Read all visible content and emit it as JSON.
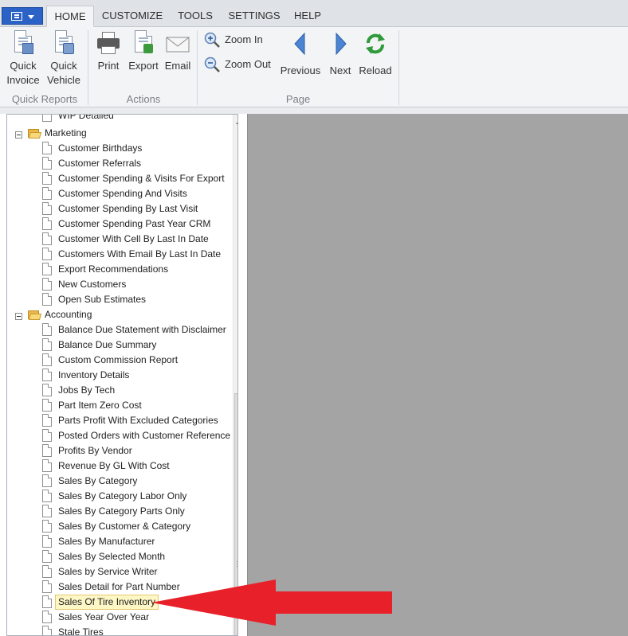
{
  "tabs": [
    {
      "label": "HOME",
      "active": true
    },
    {
      "label": "CUSTOMIZE",
      "active": false
    },
    {
      "label": "TOOLS",
      "active": false
    },
    {
      "label": "SETTINGS",
      "active": false
    },
    {
      "label": "HELP",
      "active": false
    }
  ],
  "ribbon": {
    "quick_reports": {
      "group_label": "Quick Reports",
      "buttons": [
        {
          "line1": "Quick",
          "line2": "Invoice",
          "icon": "invoice-icon"
        },
        {
          "line1": "Quick",
          "line2": "Vehicle",
          "icon": "vehicle-report-icon"
        }
      ]
    },
    "actions": {
      "group_label": "Actions",
      "buttons": [
        {
          "label": "Print",
          "icon": "printer-icon"
        },
        {
          "label": "Export",
          "icon": "export-icon"
        },
        {
          "label": "Email",
          "icon": "envelope-icon"
        }
      ]
    },
    "page": {
      "group_label": "Page",
      "zoom_in": "Zoom In",
      "zoom_out": "Zoom Out",
      "previous": "Previous",
      "next": "Next",
      "reload": "Reload"
    }
  },
  "tree": {
    "partial_top_item": "WIP Detailed",
    "marketing": {
      "label": "Marketing",
      "items": [
        "Customer Birthdays",
        "Customer Referrals",
        "Customer Spending & Visits For Export",
        "Customer Spending And Visits",
        "Customer Spending By Last Visit",
        "Customer Spending Past Year CRM",
        "Customer With Cell By Last In Date",
        "Customers With Email By Last In Date",
        "Export Recommendations",
        "New Customers",
        "Open Sub Estimates"
      ]
    },
    "accounting": {
      "label": "Accounting",
      "items": [
        "Balance Due Statement with Disclaimer",
        "Balance Due Summary",
        "Custom Commission Report",
        "Inventory Details",
        "Jobs By Tech",
        "Part Item Zero Cost",
        "Parts Profit With Excluded Categories",
        "Posted Orders with Customer Reference",
        "Profits By Vendor",
        "Revenue By GL With Cost",
        "Sales By Category",
        "Sales By Category Labor Only",
        "Sales By Category Parts Only",
        "Sales By Customer & Category",
        "Sales By Manufacturer",
        "Sales By Selected Month",
        "Sales by Service Writer",
        "Sales Detail for Part Number",
        "Sales Of Tire Inventory",
        "Sales Year Over Year",
        "Stale Tires"
      ],
      "selected_index": 18
    }
  },
  "colors": {
    "app_button": "#2b62c6",
    "preview_bg": "#a4a4a4",
    "selection_bg": "#fdf7c6",
    "arrow": "#e8202a"
  }
}
